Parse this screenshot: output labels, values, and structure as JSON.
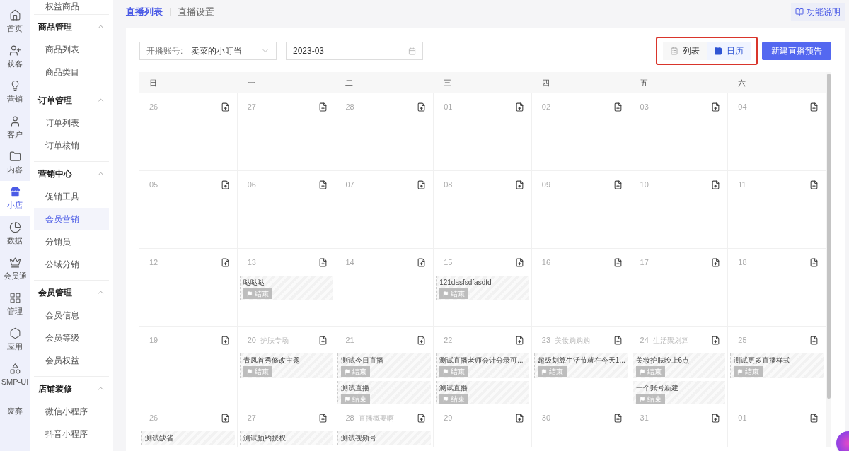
{
  "rail": [
    {
      "label": "首页",
      "selected": false
    },
    {
      "label": "获客",
      "selected": false
    },
    {
      "label": "营销",
      "selected": false
    },
    {
      "label": "客户",
      "selected": false
    },
    {
      "label": "内容",
      "selected": false
    },
    {
      "label": "小店",
      "selected": true
    },
    {
      "label": "数据",
      "selected": false
    },
    {
      "label": "会员通",
      "selected": false
    },
    {
      "label": "管理",
      "selected": false
    },
    {
      "label": "应用",
      "selected": false
    },
    {
      "label": "SMP-UI",
      "selected": false
    },
    {
      "label": "废弃",
      "selected": false
    }
  ],
  "nav": {
    "top_item": "权益商品",
    "groups": [
      {
        "title": "商品管理",
        "expanded": true,
        "items": [
          {
            "label": "商品列表",
            "selected": false
          },
          {
            "label": "商品类目",
            "selected": false
          }
        ]
      },
      {
        "title": "订单管理",
        "expanded": true,
        "items": [
          {
            "label": "订单列表",
            "selected": false
          },
          {
            "label": "订单核销",
            "selected": false
          }
        ]
      },
      {
        "title": "营销中心",
        "expanded": true,
        "items": [
          {
            "label": "促销工具",
            "selected": false
          },
          {
            "label": "会员营销",
            "selected": true
          },
          {
            "label": "分销员",
            "selected": false
          },
          {
            "label": "公域分销",
            "selected": false
          }
        ]
      },
      {
        "title": "会员管理",
        "expanded": true,
        "items": [
          {
            "label": "会员信息",
            "selected": false
          },
          {
            "label": "会员等级",
            "selected": false
          },
          {
            "label": "会员权益",
            "selected": false
          }
        ]
      },
      {
        "title": "店铺装修",
        "expanded": true,
        "items": [
          {
            "label": "微信小程序",
            "selected": false
          },
          {
            "label": "抖音小程序",
            "selected": false
          }
        ]
      }
    ]
  },
  "tabs": [
    {
      "label": "直播列表",
      "selected": true
    },
    {
      "label": "直播设置",
      "selected": false
    }
  ],
  "help_button": "功能说明",
  "filters": {
    "account_label": "开播账号:",
    "account_value": "卖菜的小叮当",
    "month": "2023-03"
  },
  "view_toggle": [
    {
      "label": "列表",
      "selected": false
    },
    {
      "label": "日历",
      "selected": true
    }
  ],
  "create_button": "新建直播预告",
  "calendar": {
    "weekdays": [
      "日",
      "一",
      "二",
      "三",
      "四",
      "五",
      "六"
    ],
    "weeks": [
      [
        {
          "date": "26"
        },
        {
          "date": "27"
        },
        {
          "date": "28"
        },
        {
          "date": "01"
        },
        {
          "date": "02"
        },
        {
          "date": "03"
        },
        {
          "date": "04"
        }
      ],
      [
        {
          "date": "05"
        },
        {
          "date": "06"
        },
        {
          "date": "07"
        },
        {
          "date": "08"
        },
        {
          "date": "09"
        },
        {
          "date": "10"
        },
        {
          "date": "11"
        }
      ],
      [
        {
          "date": "12"
        },
        {
          "date": "13",
          "events": [
            {
              "title": "哒哒哒",
              "status": "结束"
            }
          ]
        },
        {
          "date": "14"
        },
        {
          "date": "15",
          "events": [
            {
              "title": "121dasfsdfasdfd",
              "status": "结束"
            }
          ]
        },
        {
          "date": "16"
        },
        {
          "date": "17"
        },
        {
          "date": "18"
        }
      ],
      [
        {
          "date": "19"
        },
        {
          "date": "20",
          "note": "护肤专场",
          "events": [
            {
              "title": "青凤首秀修改主题",
              "status": "结束"
            }
          ]
        },
        {
          "date": "21",
          "events": [
            {
              "title": "测试今日直播",
              "status": "结束"
            },
            {
              "title": "测试直播",
              "status": "结束"
            }
          ]
        },
        {
          "date": "22",
          "events": [
            {
              "title": "测试直播老师会计分录可...",
              "status": "结束"
            },
            {
              "title": "测试直播",
              "status": "结束"
            }
          ]
        },
        {
          "date": "23",
          "note": "美妆购购购",
          "events": [
            {
              "title": "超级划算生活节就在今天1...",
              "status": "结束"
            }
          ]
        },
        {
          "date": "24",
          "note": "生活聚划算",
          "events": [
            {
              "title": "美妆护肤晚上6点",
              "status": "结束"
            },
            {
              "title": "一个账号新建",
              "status": "结束"
            }
          ]
        },
        {
          "date": "25",
          "events": [
            {
              "title": "测试更多直播样式",
              "status": "结束"
            }
          ]
        }
      ],
      [
        {
          "date": "26",
          "events": [
            {
              "title": "测试缺省"
            }
          ]
        },
        {
          "date": "27",
          "events": [
            {
              "title": "测试预约授权"
            }
          ]
        },
        {
          "date": "28",
          "note": "直播概要啊",
          "events": [
            {
              "title": "测试视频号"
            }
          ]
        },
        {
          "date": "29"
        },
        {
          "date": "30"
        },
        {
          "date": "31"
        },
        {
          "date": "01"
        }
      ]
    ]
  }
}
